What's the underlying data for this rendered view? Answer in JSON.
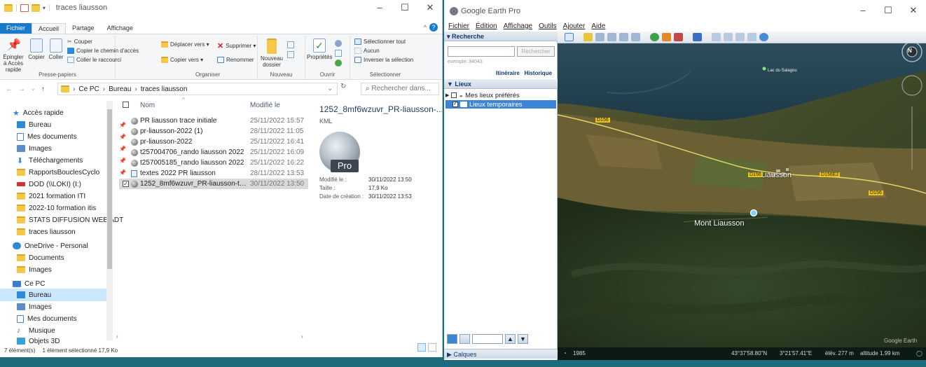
{
  "explorer": {
    "title": "traces liausson",
    "ribbon_tabs": [
      "Fichier",
      "Accueil",
      "Partage",
      "Affichage"
    ],
    "ribbon": {
      "pin_quick": "Épingler à Accès rapide",
      "copy": "Copier",
      "paste": "Coller",
      "cut": "Couper",
      "copy_path": "Copier le chemin d'accès",
      "paste_shortcut": "Coller le raccourci",
      "group_clipboard": "Presse-papiers",
      "move_to": "Déplacer vers ▾",
      "copy_to": "Copier vers ▾",
      "delete": "Supprimer ▾",
      "rename": "Renommer",
      "group_organize": "Organiser",
      "new_folder": "Nouveau dossier",
      "group_new": "Nouveau",
      "properties": "Propriétés",
      "group_open": "Ouvrir",
      "select_all": "Sélectionner tout",
      "select_none": "Aucun",
      "invert_selection": "Inverser la sélection",
      "group_select": "Sélectionner"
    },
    "address": {
      "segments": [
        "Ce PC",
        "Bureau",
        "traces liausson"
      ],
      "search_placeholder": "Rechercher dans..."
    },
    "sidebar": [
      {
        "label": "Accès rapide"
      },
      {
        "label": "Bureau"
      },
      {
        "label": "Mes documents"
      },
      {
        "label": "Images"
      },
      {
        "label": "Téléchargements"
      },
      {
        "label": "RapportsBouclesCyclo"
      },
      {
        "label": "DOD (\\\\LOKI) (I:)"
      },
      {
        "label": "2021 formation ITI"
      },
      {
        "label": "2022-10 formation itis"
      },
      {
        "label": "STATS DIFFUSION WEB ADT"
      },
      {
        "label": "traces liausson"
      },
      {
        "label": "OneDrive - Personal"
      },
      {
        "label": "Documents"
      },
      {
        "label": "Images"
      },
      {
        "label": "Ce PC"
      },
      {
        "label": "Bureau"
      },
      {
        "label": "Images"
      },
      {
        "label": "Mes documents"
      },
      {
        "label": "Musique"
      },
      {
        "label": "Objets 3D"
      }
    ],
    "columns": {
      "name": "Nom",
      "modified": "Modifié le"
    },
    "files": [
      {
        "name": "PR liausson trace initiale",
        "date": "25/11/2022 15:57"
      },
      {
        "name": "pr-liausson-2022 (1)",
        "date": "28/11/2022 11:05"
      },
      {
        "name": "pr-liausson-2022",
        "date": "25/11/2022 16:41"
      },
      {
        "name": "t257004706_rando liausson 2022",
        "date": "25/11/2022 16:09"
      },
      {
        "name": "t257005185_rando liausson 2022",
        "date": "25/11/2022 16:22"
      },
      {
        "name": "textes 2022 PR liausson",
        "date": "28/11/2022 13:53"
      },
      {
        "name": "1252_8mf6wzuvr_PR-liausson-trace...",
        "date": "30/11/2022 13:50"
      }
    ],
    "preview": {
      "title": "1252_8mf6wzuvr_PR-liausson-...",
      "type": "KML",
      "logo_badge": "Pro",
      "modified_label": "Modifié le :",
      "modified_value": "30/11/2022 13:50",
      "size_label": "Taille :",
      "size_value": "17,9 Ko",
      "created_label": "Date de création :",
      "created_value": "30/11/2022 13:53"
    },
    "status": {
      "count": "7 élément(s)",
      "selection": "1 élément sélectionné  17,9 Ko"
    }
  },
  "earth": {
    "title": "Google Earth Pro",
    "menu": [
      "Fichier",
      "Édition",
      "Affichage",
      "Outils",
      "Ajouter",
      "Aide"
    ],
    "search": {
      "header": "▾ Recherche",
      "button": "Rechercher",
      "example": "exemple: 94043",
      "itinerary": "Itinéraire",
      "history": "Historique"
    },
    "places": {
      "header": "▼ Lieux",
      "items": [
        {
          "label": "Mes lieux préférés"
        },
        {
          "label": "Lieux temporaires"
        }
      ]
    },
    "layers_header": "▶ Calques",
    "map": {
      "labels": {
        "lake": "Lac du Salagou",
        "town": "Liausson",
        "mount": "Mont Liausson",
        "road_1": "D156",
        "road_2": "D156",
        "road_3": "D156E2",
        "road_4": "D156",
        "watermark": "Google Earth",
        "compass": "N"
      }
    },
    "status": {
      "year": "1985",
      "lat": "43°37'58.80\"N",
      "lon": "3°21'57.41\"E",
      "elev": "élév.  277 m",
      "altitude": "altitude   1.99 km"
    }
  }
}
